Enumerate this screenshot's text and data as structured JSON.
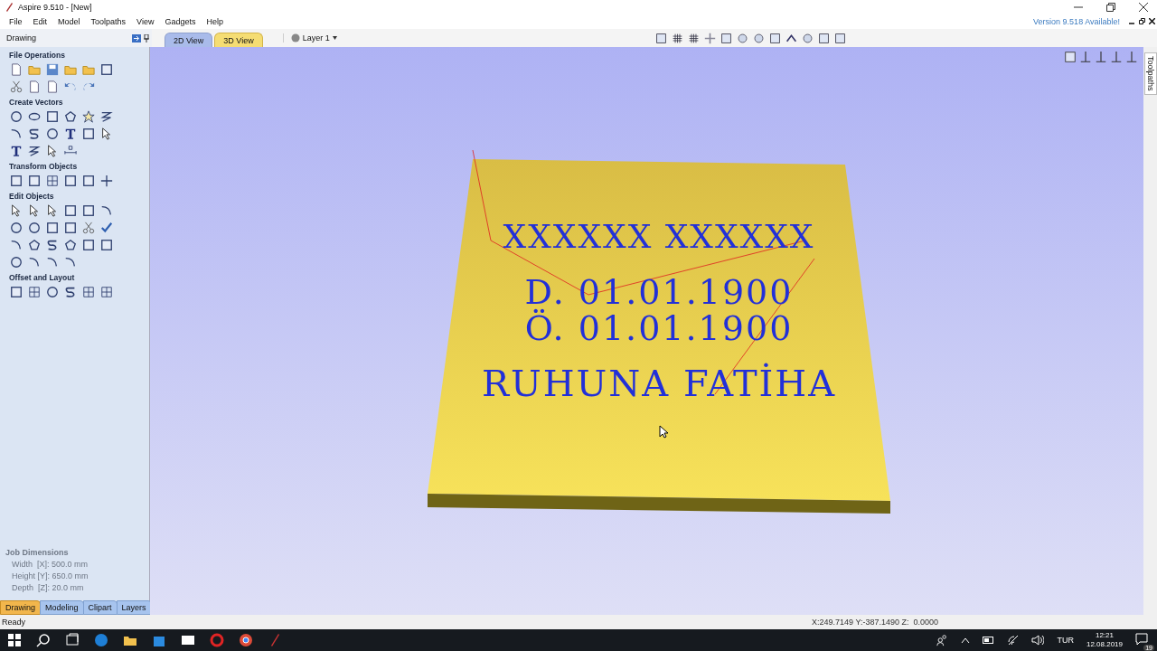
{
  "window": {
    "title": "Aspire 9.510 - [New]",
    "update_notice": "Version 9.518 Available!"
  },
  "menu": [
    "File",
    "Edit",
    "Model",
    "Toolpaths",
    "View",
    "Gadgets",
    "Help"
  ],
  "panel": {
    "title": "Drawing",
    "sections": [
      {
        "title": "File Operations"
      },
      {
        "title": "Create Vectors"
      },
      {
        "title": "Transform Objects"
      },
      {
        "title": "Edit Objects"
      },
      {
        "title": "Offset and Layout"
      }
    ],
    "job_dimensions": {
      "title": "Job Dimensions",
      "lines": [
        "Width  [X]: 500.0 mm",
        "Height [Y]: 650.0 mm",
        "Depth  [Z]: 20.0 mm"
      ]
    },
    "tabs": [
      {
        "label": "Drawing",
        "selected": true
      },
      {
        "label": "Modeling",
        "selected": false
      },
      {
        "label": "Clipart",
        "selected": false
      },
      {
        "label": "Layers",
        "selected": false
      }
    ]
  },
  "view_tabs": [
    {
      "label": "2D View",
      "selected": false
    },
    {
      "label": "3D View",
      "selected": true
    }
  ],
  "layer": "Layer 1",
  "side_tab": "Toolpaths",
  "model": {
    "lines": [
      "XXXXXX XXXXXX",
      "D. 01.01.1900",
      "Ö. 01.01.1900",
      "RUHUNA FATİHA"
    ]
  },
  "status": {
    "text": "Ready",
    "coordinates": "X:249.7149 Y:-387.1490 Z:  0.0000"
  },
  "taskbar": {
    "language": "TUR",
    "time": "12:21",
    "date": "12.08.2019",
    "notifications": "19"
  }
}
